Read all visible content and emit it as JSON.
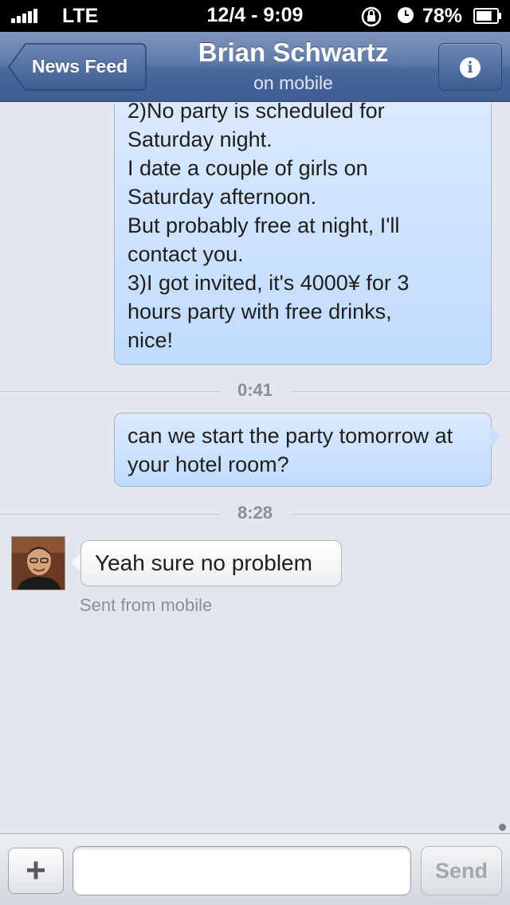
{
  "status_bar": {
    "carrier": "LTE",
    "time": "12/4 - 9:09",
    "battery_percent": "78%",
    "signal_bars": 5,
    "battery_level": 0.78
  },
  "nav": {
    "back_label": "News Feed",
    "title": "Brian Schwartz",
    "subtitle": "on mobile",
    "info_icon": "info-icon"
  },
  "messages": {
    "outgoing_1": "2)No party is scheduled for\nSaturday night.\nI date a couple of girls on\nSaturday afternoon.\nBut probably free at night, I'll\ncontact you.\n3)I got invited, it's 4000¥ for 3\nhours party with free drinks,\nnice!",
    "timestamp_1": "0:41",
    "outgoing_2": "can we start the party tomorrow at your hotel room?",
    "timestamp_2": "8:28",
    "incoming_1": "Yeah sure no problem",
    "incoming_meta": "Sent from mobile"
  },
  "compose": {
    "plus_label": "+",
    "input_value": "",
    "input_placeholder": "",
    "send_label": "Send"
  },
  "colors": {
    "nav_bar": "#4a679c",
    "outgoing_bubble": "#c9e0ff",
    "background": "#e3e6ec"
  }
}
